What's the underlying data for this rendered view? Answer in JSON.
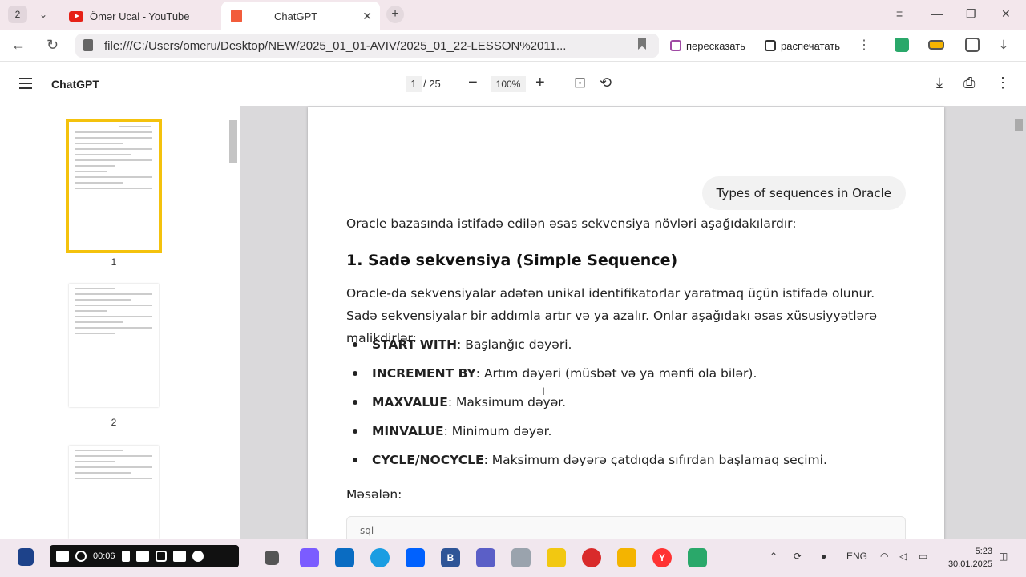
{
  "tabs": {
    "count": "2",
    "inactive_title": "Ömər Ucal - YouTube",
    "active_title": "ChatGPT"
  },
  "address": {
    "url": "file:///C:/Users/omeru/Desktop/NEW/2025_01_01-AVIV/2025_01_22-LESSON%2011...",
    "retell_label": "пересказать",
    "print_label": "распечатать"
  },
  "pdf": {
    "title": "ChatGPT",
    "page_current": "1",
    "page_total": "/ 25",
    "zoom": "100%"
  },
  "thumbnails": {
    "labels": [
      "1",
      "2"
    ]
  },
  "document": {
    "query": "Types of sequences in Oracle",
    "intro": "Oracle bazasında istifadə edilən əsas sekvensiya növləri aşağıdakılardır:",
    "heading": "1. Sadə sekvensiya (Simple Sequence)",
    "paragraph": "Oracle-da sekvensiyalar adətən unikal identifikatorlar yaratmaq üçün istifadə olunur. Sadə sekvensiyalar bir addımla artır və ya azalır. Onlar aşağıdakı əsas xüsusiyyətlərə malikdirlər:",
    "bullets": [
      {
        "term": "START WITH",
        "desc": ": Başlanğıc dəyəri."
      },
      {
        "term": "INCREMENT BY",
        "desc": ": Artım dəyəri (müsbət və ya mənfi ola bilər)."
      },
      {
        "term": "MAXVALUE",
        "desc": ": Maksimum dəyər."
      },
      {
        "term": "MINVALUE",
        "desc": ": Minimum dəyər."
      },
      {
        "term": "CYCLE/NOCYCLE",
        "desc": ": Maksimum dəyərə çatdıqda sıfırdan başlamaq seçimi."
      }
    ],
    "example_label": "Məsələn:",
    "code_lang": "sql"
  },
  "taskbar": {
    "rec_time": "00:06",
    "lang": "ENG",
    "time": "5:23",
    "date": "30.01.2025"
  },
  "colors": {
    "thumb_highlight": "#f4c20d",
    "youtube_red": "#e62117",
    "pdf_orange": "#f25c3b"
  }
}
